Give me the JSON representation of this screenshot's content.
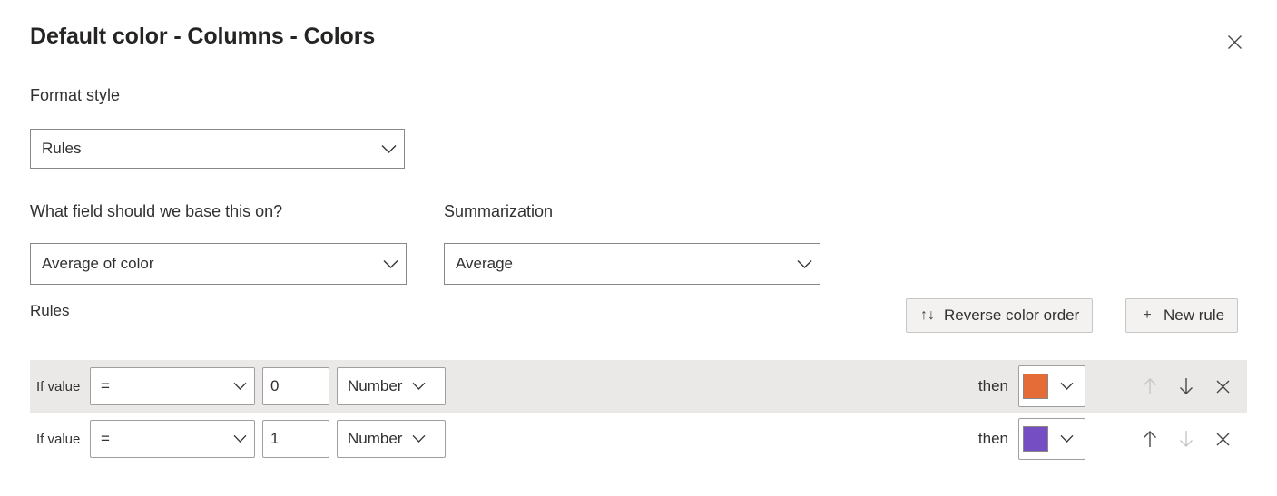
{
  "dialog": {
    "title": "Default color - Columns - Colors",
    "close_icon": "close-icon"
  },
  "format_style": {
    "label": "Format style",
    "value": "Rules",
    "chevron_icon": "chevron-down-icon"
  },
  "base_field": {
    "label": "What field should we base this on?",
    "value": "Average of color",
    "chevron_icon": "chevron-down-icon"
  },
  "summarization": {
    "label": "Summarization",
    "value": "Average",
    "chevron_icon": "chevron-down-icon"
  },
  "rules_section": {
    "label": "Rules",
    "reverse_button": {
      "label": "Reverse color order",
      "icon": "arrow-up-down-icon",
      "glyph": "↑↓"
    },
    "new_rule_button": {
      "label": "New rule",
      "icon": "plus-icon",
      "glyph": "+"
    }
  },
  "rules": [
    {
      "if_label": "If value",
      "operator": "=",
      "value": "0",
      "value_placeholder": "",
      "type": "Number",
      "then_label": "then",
      "color": "#E66C37",
      "move_up_enabled": false,
      "move_down_enabled": true,
      "remove_icon": "close-icon",
      "row_background": "#EBE9E7"
    },
    {
      "if_label": "If value",
      "operator": "=",
      "value": "1",
      "value_placeholder": "",
      "type": "Number",
      "then_label": "then",
      "color": "#744EC2",
      "move_up_enabled": true,
      "move_down_enabled": false,
      "remove_icon": "close-icon",
      "row_background": "#FFFFFF"
    }
  ],
  "colors": {
    "text": "#323130",
    "title": "#252423",
    "border": "#8A8886",
    "row_alt_background": "#EBE9E7",
    "button_background": "#F3F2F1",
    "icon_enabled": "#605E5C",
    "icon_disabled": "#C8C6C4"
  }
}
